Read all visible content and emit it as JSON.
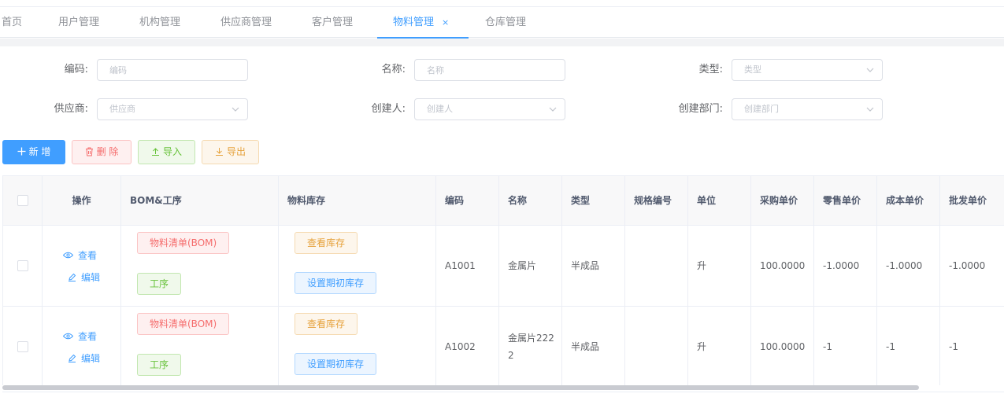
{
  "tabs": [
    {
      "label": "首页"
    },
    {
      "label": "用户管理"
    },
    {
      "label": "机构管理"
    },
    {
      "label": "供应商管理"
    },
    {
      "label": "客户管理"
    },
    {
      "label": "物料管理",
      "active": true,
      "close": "×"
    },
    {
      "label": "仓库管理"
    }
  ],
  "search": {
    "code_label": "编码:",
    "code_placeholder": "编码",
    "name_label": "名称:",
    "name_placeholder": "名称",
    "type_label": "类型:",
    "type_placeholder": "类型",
    "supplier_label": "供应商:",
    "supplier_placeholder": "供应商",
    "creator_label": "创建人:",
    "creator_placeholder": "创建人",
    "dept_label": "创建部门:",
    "dept_placeholder": "创建部门"
  },
  "toolbar": {
    "add_label": "新 增",
    "delete_label": "删 除",
    "import_label": "导入",
    "export_label": "导出"
  },
  "table": {
    "headers": {
      "action": "操作",
      "bom": "BOM&工序",
      "stock": "物料库存",
      "code": "编码",
      "name": "名称",
      "type": "类型",
      "spec": "规格编号",
      "unit": "单位",
      "purchase": "采购单价",
      "retail": "零售单价",
      "cost": "成本单价",
      "wholesale": "批发单价"
    },
    "actions": {
      "view": "查看",
      "edit": "编辑"
    },
    "tags": {
      "bom": "物料清单(BOM)",
      "process": "工序",
      "view_stock": "查看库存",
      "init_stock": "设置期初库存"
    },
    "rows": [
      {
        "code": "A1001",
        "name": "金属片",
        "type": "半成品",
        "spec": "",
        "unit": "升",
        "purchase": "100.0000",
        "retail": "-1.0000",
        "cost": "-1.0000",
        "wholesale": "-1.0000"
      },
      {
        "code": "A1002",
        "name": "金属片2222",
        "type": "半成品",
        "spec": "",
        "unit": "升",
        "purchase": "100.0000",
        "retail": "-1",
        "cost": "-1",
        "wholesale": "-1"
      }
    ]
  },
  "colors": {
    "primary": "#409eff",
    "danger": "#f56c6c",
    "success": "#67c23a",
    "warning": "#e6a23c"
  }
}
